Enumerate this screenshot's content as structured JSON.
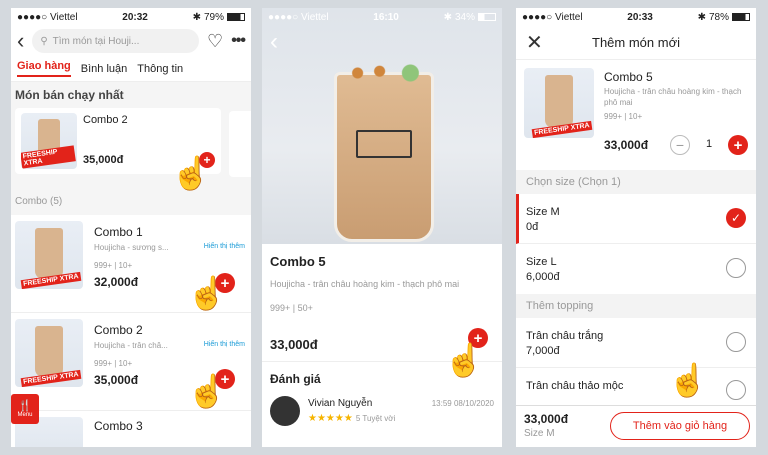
{
  "status": [
    {
      "carrier": "●●●●○ Viettel",
      "time": "20:32",
      "battery": "79%"
    },
    {
      "carrier": "●●●●○ Viettel",
      "time": "16:10",
      "battery": "34%"
    },
    {
      "carrier": "●●●●○ Viettel",
      "time": "20:33",
      "battery": "78%"
    }
  ],
  "screen1": {
    "search_placeholder": "Tìm món tại Houji...",
    "tabs": [
      "Giao hàng",
      "Bình luận",
      "Thông tin"
    ],
    "bestseller_title": "Món bán chạy nhất",
    "bestseller_item": {
      "name": "Combo 2",
      "price": "35,000đ",
      "badge": "FREESHIP XTRA"
    },
    "combo_section": "Combo (5)",
    "items": [
      {
        "name": "Combo 1",
        "desc": "Houjicha - sương s...",
        "more": "Hiển thị thêm",
        "stats": "999+ | 10+",
        "price": "32,000đ",
        "badge": "FREESHIP XTRA"
      },
      {
        "name": "Combo 2",
        "desc": "Houjicha - trân châ...",
        "more": "Hiển thị thêm",
        "stats": "999+ | 10+",
        "price": "35,000đ",
        "badge": "FREESHIP XTRA"
      },
      {
        "name": "Combo 3"
      }
    ],
    "menu_label": "Menu"
  },
  "screen2": {
    "name": "Combo 5",
    "desc": "Houjicha - trân châu hoàng kim - thạch phô mai",
    "stats": "999+ | 50+",
    "price": "33,000đ",
    "reviews_title": "Đánh giá",
    "review": {
      "user": "Vivian Nguyễn",
      "datetime": "13:59 08/10/2020",
      "stars": "★★★★★",
      "rating_text": "5 Tuyệt vời"
    }
  },
  "screen3": {
    "title": "Thêm món mới",
    "item": {
      "name": "Combo 5",
      "desc": "Houjicha - trân châu hoàng kim - thạch phô mai",
      "stats": "999+ | 10+",
      "price": "33,000đ",
      "qty": "1",
      "badge": "FREESHIP XTRA"
    },
    "size_header": "Chọn size (Chọn 1)",
    "sizes": [
      {
        "name": "Size M",
        "price": "0đ",
        "selected": true
      },
      {
        "name": "Size L",
        "price": "6,000đ",
        "selected": false
      }
    ],
    "topping_header": "Thêm topping",
    "toppings": [
      {
        "name": "Trân châu trắng",
        "price": "7,000đ"
      },
      {
        "name": "Trân châu thảo mộc",
        "price": ""
      }
    ],
    "footer_price": "33,000đ",
    "footer_size": "Size M",
    "add_button": "Thêm vào giỏ hàng"
  }
}
